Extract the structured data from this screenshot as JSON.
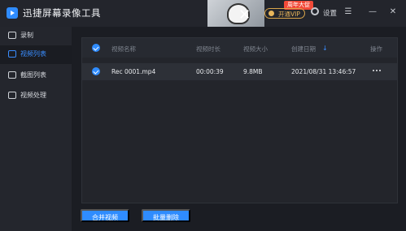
{
  "app": {
    "title": "迅捷屏幕录像工具"
  },
  "header": {
    "promo_badge": "周年大促",
    "vip_label": "开通VIP",
    "settings_label": "设置",
    "menu_icon": "☰",
    "minimize_icon": "—",
    "close_icon": "✕"
  },
  "sidebar": {
    "items": [
      {
        "label": "录制",
        "icon": "camera-icon"
      },
      {
        "label": "视频列表",
        "icon": "video-list-icon"
      },
      {
        "label": "截图列表",
        "icon": "screenshot-list-icon"
      },
      {
        "label": "视频处理",
        "icon": "video-process-icon"
      }
    ]
  },
  "table": {
    "columns": [
      "视频名称",
      "视频时长",
      "视频大小",
      "创建日期",
      "操作"
    ],
    "sort_icon": "↓",
    "rows": [
      {
        "name": "Rec 0001.mp4",
        "duration": "00:00:39",
        "size": "9.8MB",
        "date": "2021/08/31 13:46:57"
      }
    ]
  },
  "actions": {
    "merge_label": "合并视频",
    "delete_label": "批量删除"
  },
  "colors": {
    "accent": "#2f8cff",
    "background": "#1b1d23",
    "sidebar": "#24262d",
    "promo": "#f24a38"
  }
}
